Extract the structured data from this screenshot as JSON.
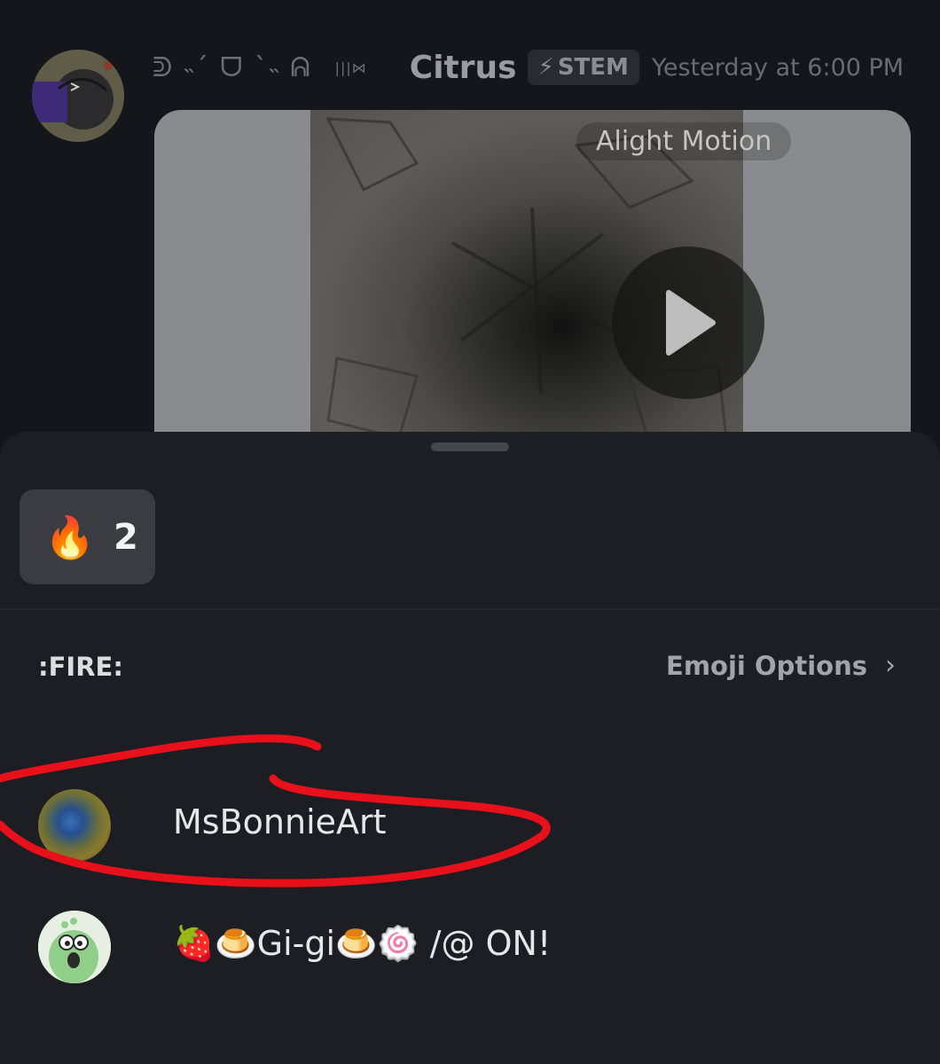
{
  "message": {
    "decorative_name": "ᕲ ˵´ ᗜ `˵ ᕱ",
    "decorative_tail": "|||⋈",
    "username": "Citrus",
    "tag": {
      "icon": "lightning-icon",
      "glyph": "⚡",
      "label": "STEM"
    },
    "timestamp": "Yesterday at 6:00 PM",
    "video": {
      "watermark": "Alight Motion",
      "play_icon": "play-icon"
    }
  },
  "reactions_sheet": {
    "reaction": {
      "emoji": "🔥",
      "count": "2"
    },
    "emoji_name": ":FIRE:",
    "emoji_options_label": "Emoji Options",
    "chevron": "›",
    "users": [
      {
        "name": "MsBonnieArt"
      },
      {
        "name": "🍓🍮Gi-gi🍮🍥 /@ ON!"
      }
    ]
  },
  "colors": {
    "sheet_bg": "#1d1e23",
    "chip_bg": "#3b3c42",
    "annotation_red": "#e8101a"
  }
}
